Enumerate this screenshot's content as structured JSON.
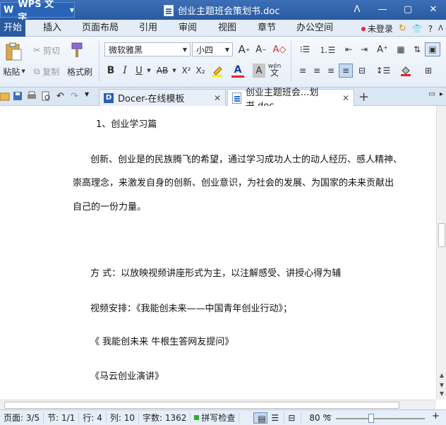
{
  "app": {
    "logo": "W",
    "name": "WPS 文字"
  },
  "title": {
    "doc_name": "创业主题班会策划书.doc"
  },
  "window_controls": [
    "ᐱ",
    "—",
    "▢",
    "✕"
  ],
  "menu": {
    "tabs": [
      "开始",
      "插入",
      "页面布局",
      "引用",
      "审阅",
      "视图",
      "章节",
      "办公空间"
    ],
    "login": "未登录"
  },
  "ribbon": {
    "paste": "粘贴",
    "cut": "剪切",
    "copy": "复制",
    "format_painter": "格式刷",
    "font_name": "微软雅黑",
    "font_size": "小四",
    "bold": "B",
    "italic": "I",
    "underline": "U",
    "strike": "AB",
    "superscript": "X²",
    "subscript": "X₂",
    "font_color_letter": "A",
    "char_shade_letter": "A",
    "pinyin": "wén"
  },
  "doc_tabs": [
    {
      "label": "Docer-在线模板"
    },
    {
      "label": "创业主题班会...划书.doc"
    }
  ],
  "document": {
    "heading": "1、创业学习篇",
    "para1_line1": "创新、创业是的民族腾飞的希望，通过学习成功人士的动人经历、感人精神、",
    "para1_line2": "崇高理念，来激发自身的创新、创业意识，为社会的发展、为国家的未来贡献出",
    "para1_line3": "自己的一份力量。",
    "method": "方  式：以放映视频讲座形式为主，以注解感受、讲授心得为辅",
    "video": "视频安排：《我能创未来——中国青年创业行动》；",
    "item1": "《  我能创未来  牛根生答网友提问》",
    "item2": "《马云创业演讲》"
  },
  "status": {
    "page": "页面: 3/5",
    "section": "节: 1/1",
    "row": "行: 4",
    "col": "列: 10",
    "words": "字数: 1362",
    "spell": "拼写检查",
    "zoom": "80 %",
    "zoom_level": 0.4
  },
  "colors": {
    "accent": "#2a5a9f",
    "ribbon_bg": "#e6eef8"
  }
}
